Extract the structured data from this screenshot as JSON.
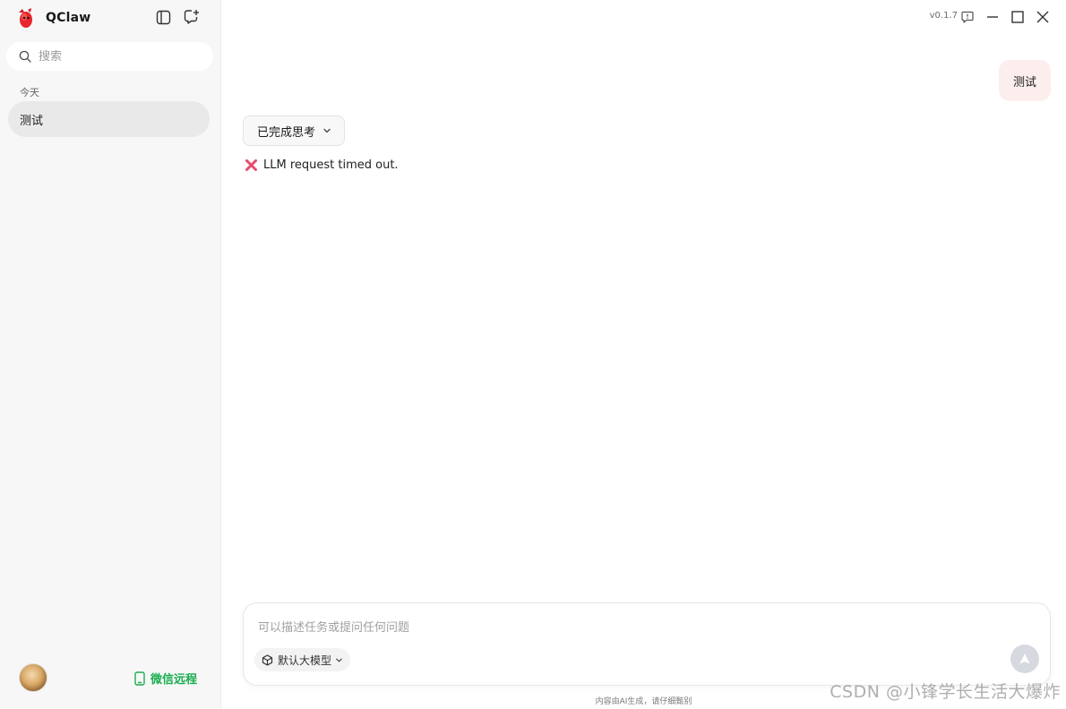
{
  "app": {
    "name": "QClaw",
    "version": "v0.1.7"
  },
  "sidebar": {
    "search_placeholder": "搜索",
    "group_label": "今天",
    "conversations": [
      {
        "label": "测试"
      }
    ],
    "wechat_remote_label": "微信远程"
  },
  "chat": {
    "user_message": "测试",
    "thinking_label": "已完成思考",
    "error_message": "LLM request timed out."
  },
  "composer": {
    "placeholder": "可以描述任务或提问任何问题",
    "model_label": "默认大模型",
    "disclaimer": "内容由AI生成，请仔细甄别"
  },
  "watermark": "CSDN @小锋学长生活大爆炸",
  "icons": {
    "logo": "red-claw-logo-icon",
    "sidebar_toggle": "sidebar-toggle-icon",
    "new_chat": "new-chat-icon",
    "search": "search-icon",
    "feedback": "feedback-icon",
    "minimize": "minimize-icon",
    "maximize": "maximize-icon",
    "close": "close-icon",
    "chevron": "chevron-down-icon",
    "error": "cross-mark-icon",
    "model": "cube-icon",
    "send": "send-arrow-icon",
    "phone": "phone-icon"
  },
  "colors": {
    "accent_green": "#1aad4e",
    "user_bubble": "#fdeeee",
    "error_red": "#e84a6a"
  }
}
